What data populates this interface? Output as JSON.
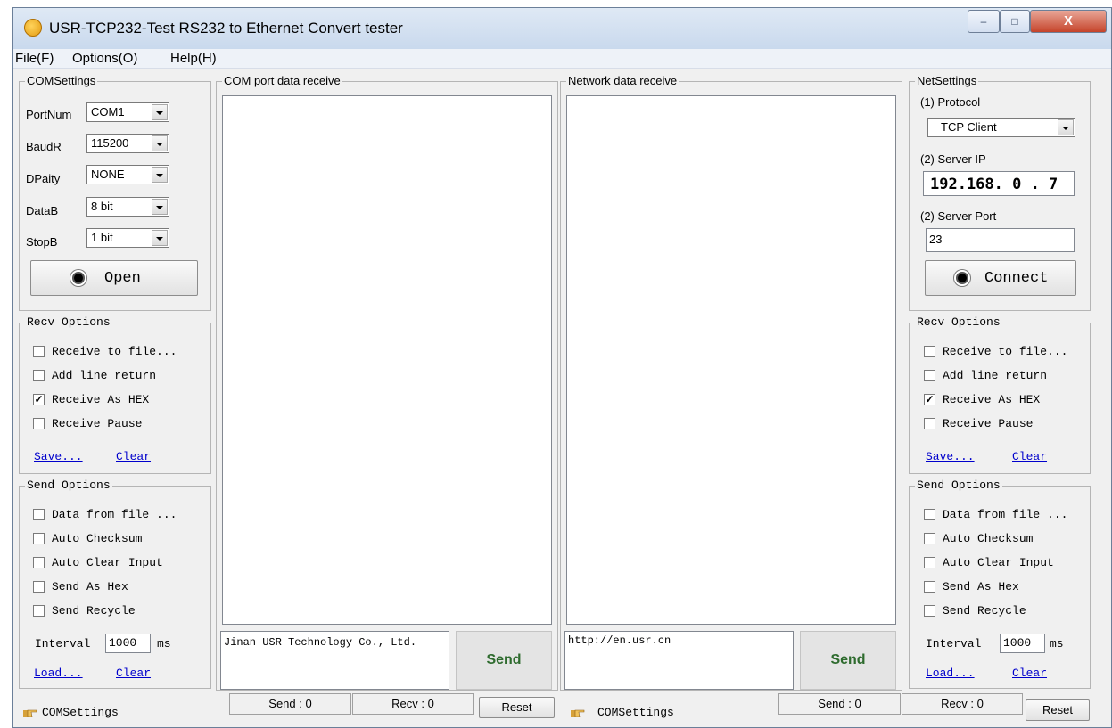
{
  "window": {
    "title": "USR-TCP232-Test  RS232 to Ethernet Convert tester",
    "controls": {
      "minimize": "–",
      "maximize": "□",
      "close": "X"
    }
  },
  "menu": [
    "File(F)",
    "Options(O)",
    "Help(H)"
  ],
  "com_settings": {
    "title": "COMSettings",
    "fields": [
      {
        "label": "PortNum",
        "value": "COM1"
      },
      {
        "label": "BaudR",
        "value": "115200"
      },
      {
        "label": "DPaity",
        "value": "NONE"
      },
      {
        "label": "DataB",
        "value": "8 bit"
      },
      {
        "label": "StopB",
        "value": "1 bit"
      }
    ],
    "open_label": "Open"
  },
  "left_recv": {
    "title": "Recv Options",
    "options": [
      {
        "label": "Receive to file...",
        "checked": false
      },
      {
        "label": "Add line return",
        "checked": false
      },
      {
        "label": "Receive As HEX",
        "checked": true
      },
      {
        "label": "Receive Pause",
        "checked": false
      }
    ],
    "save_label": "Save...",
    "clear_label": "Clear"
  },
  "left_send": {
    "title": "Send Options",
    "options": [
      {
        "label": "Data from file ...",
        "checked": false
      },
      {
        "label": "Auto Checksum",
        "checked": false
      },
      {
        "label": "Auto Clear Input",
        "checked": false
      },
      {
        "label": "Send As Hex",
        "checked": false
      },
      {
        "label": "Send Recycle",
        "checked": false
      }
    ],
    "interval_label": "Interval",
    "interval_value": "1000",
    "interval_unit": "ms",
    "load_label": "Load...",
    "clear_label": "Clear"
  },
  "com_receive": {
    "title": "COM port data receive",
    "send_text": "Jinan USR Technology Co., Ltd.",
    "send_label": "Send"
  },
  "net_receive": {
    "title": "Network data receive",
    "send_text": "http://en.usr.cn",
    "send_label": "Send"
  },
  "net_settings": {
    "title": "NetSettings",
    "protocol_label": "(1) Protocol",
    "protocol_value": "TCP Client",
    "server_ip_label": "(2) Server IP",
    "server_ip_value": "192.168. 0 . 7",
    "server_port_label": "(2) Server Port",
    "server_port_value": "23",
    "connect_label": "Connect"
  },
  "right_recv": {
    "title": "Recv Options",
    "options": [
      {
        "label": "Receive to file...",
        "checked": false
      },
      {
        "label": "Add line return",
        "checked": false
      },
      {
        "label": "Receive As HEX",
        "checked": true
      },
      {
        "label": "Receive Pause",
        "checked": false
      }
    ],
    "save_label": "Save...",
    "clear_label": "Clear"
  },
  "right_send": {
    "title": "Send Options",
    "options": [
      {
        "label": "Data from file ...",
        "checked": false
      },
      {
        "label": "Auto Checksum",
        "checked": false
      },
      {
        "label": "Auto Clear Input",
        "checked": false
      },
      {
        "label": "Send As Hex",
        "checked": false
      },
      {
        "label": "Send Recycle",
        "checked": false
      }
    ],
    "interval_label": "Interval",
    "interval_value": "1000",
    "interval_unit": "ms",
    "load_label": "Load...",
    "clear_label": "Clear"
  },
  "status": {
    "left_label": "COMSettings",
    "left_send": "Send : 0",
    "left_recv": "Recv : 0",
    "left_reset": "Reset",
    "right_label": "COMSettings",
    "right_send": "Send : 0",
    "right_recv": "Recv : 0",
    "right_reset": "Reset"
  },
  "colors": {
    "link": "#0000cc",
    "send_button_text": "#2e6b2e",
    "title_bar": "#c9d9ed"
  }
}
